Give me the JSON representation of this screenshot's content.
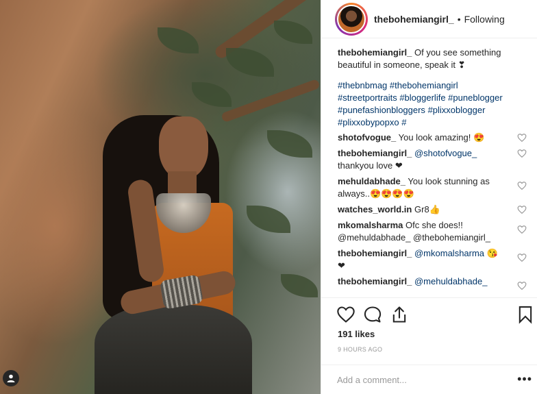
{
  "colors": {
    "text": "#262626",
    "link": "#003569",
    "muted": "#999999",
    "border": "#efefef",
    "ring": "#dd2a7b"
  },
  "header": {
    "username": "thebohemiangirl_",
    "separator": "•",
    "follow_status": "Following"
  },
  "caption": {
    "username": "thebohemiangirl_",
    "text": "Of you see something beautiful in someone, speak it ❣",
    "hashtags": [
      "#thebnbmag",
      "#thebohemiangirl",
      "#streetportraits",
      "#bloggerlife",
      "#puneblogger",
      "#punefashionbloggers",
      "#plixxoblogger",
      "#plixxobypopxo",
      "#"
    ]
  },
  "comments": [
    {
      "username": "shotofvogue_",
      "mention": "",
      "text": "You look amazing! 😍"
    },
    {
      "username": "thebohemiangirl_",
      "mention": "@shotofvogue_",
      "text": "thankyou love ❤"
    },
    {
      "username": "mehuldabhade_",
      "mention": "",
      "text": "You look stunning as always..😍😍😍😍"
    },
    {
      "username": "watches_world.in",
      "mention": "",
      "text": "Gr8👍"
    },
    {
      "username": "mkomalsharma",
      "mention": "",
      "text": "Ofc she does!! @mehuldabhade_ @thebohemiangirl_"
    },
    {
      "username": "thebohemiangirl_",
      "mention": "@mkomalsharma",
      "text": "😘 ❤"
    },
    {
      "username": "thebohemiangirl_",
      "mention": "@mehuldabhade_",
      "text": ""
    }
  ],
  "likes": "191 likes",
  "time": "9 HOURS AGO",
  "add_comment": {
    "placeholder": "Add a comment..."
  },
  "more": "•••",
  "icons": {
    "like": "heart-icon",
    "comment": "comment-bubble-icon",
    "share": "share-icon",
    "save": "bookmark-icon",
    "tag": "user-tag-icon"
  }
}
